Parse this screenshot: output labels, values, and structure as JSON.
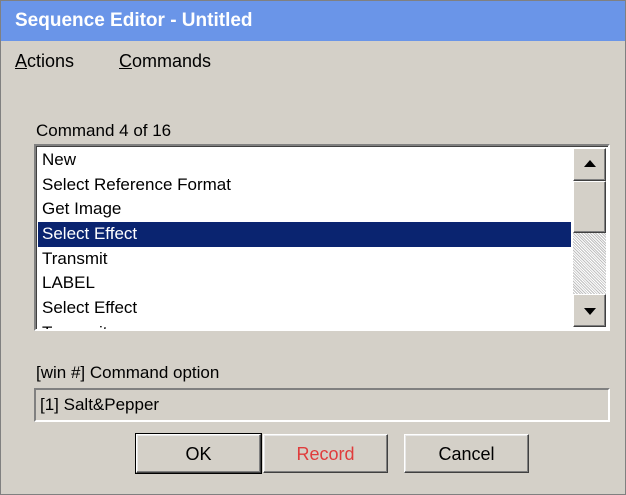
{
  "window": {
    "title": "Sequence Editor - Untitled"
  },
  "menu": [
    {
      "mnemonic": "A",
      "rest": "ctions"
    },
    {
      "mnemonic": "C",
      "rest": "ommands"
    }
  ],
  "command_counter": "Command 4 of 16",
  "commands": [
    {
      "label": "New"
    },
    {
      "label": "Select Reference Format"
    },
    {
      "label": "Get Image"
    },
    {
      "label": "Select Effect",
      "selected": true
    },
    {
      "label": "Transmit"
    },
    {
      "label": "LABEL"
    },
    {
      "label": "Select Effect"
    },
    {
      "label": "Transmit"
    }
  ],
  "option_header": "[win #]  Command option",
  "option_value": "[1]  Salt&Pepper",
  "buttons": {
    "ok": "OK",
    "record": "Record",
    "cancel": "Cancel"
  },
  "colors": {
    "titlebar": "#6a95e8",
    "selection": "#0a2470",
    "record_text": "#e03c3c"
  }
}
